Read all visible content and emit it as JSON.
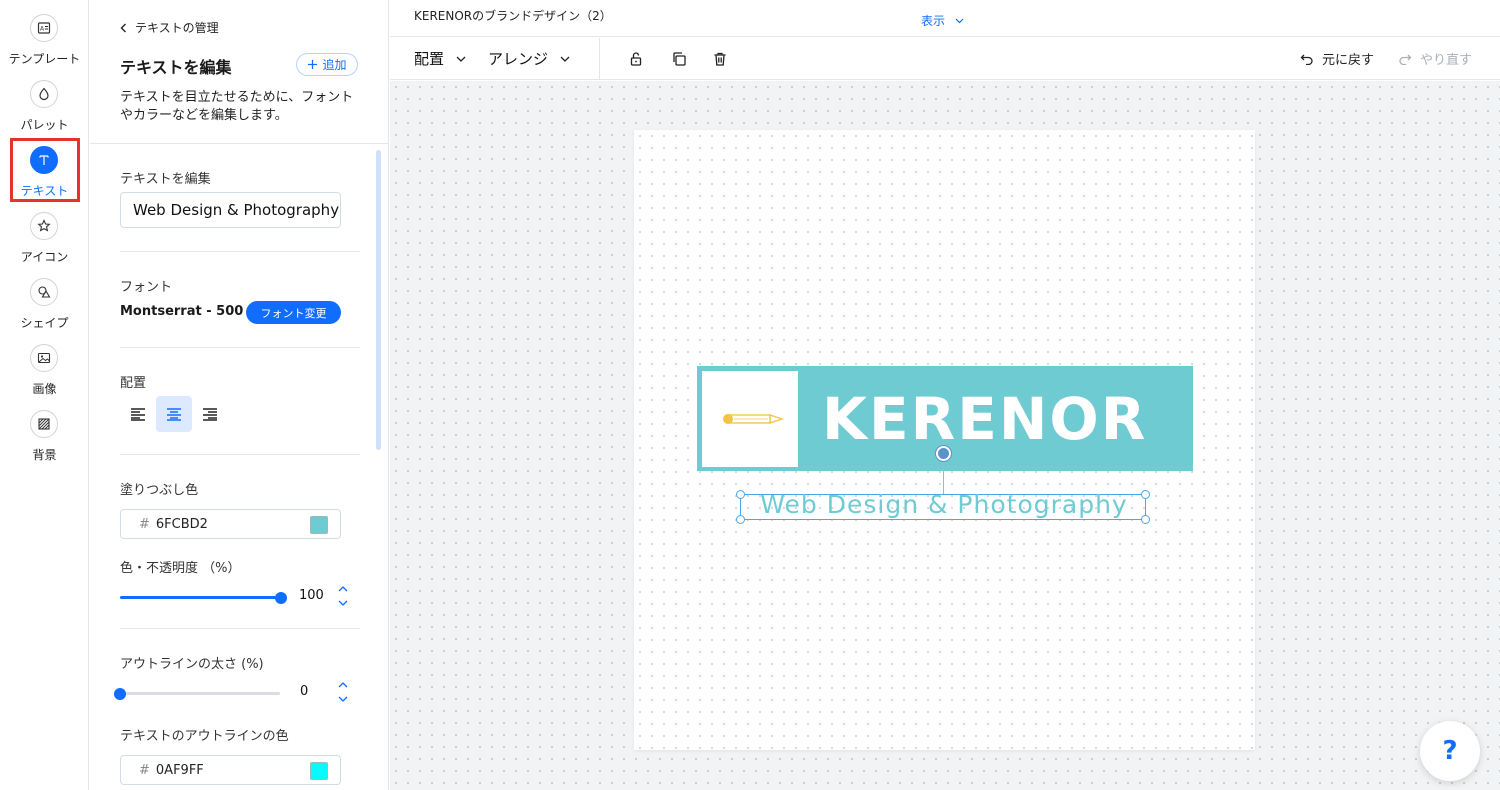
{
  "rail": {
    "items": [
      {
        "label": "テンプレート",
        "icon": "template-icon"
      },
      {
        "label": "パレット",
        "icon": "palette-icon"
      },
      {
        "label": "テキスト",
        "icon": "text-icon"
      },
      {
        "label": "アイコン",
        "icon": "star-icon"
      },
      {
        "label": "シェイプ",
        "icon": "shapes-icon"
      },
      {
        "label": "画像",
        "icon": "image-icon"
      },
      {
        "label": "背景",
        "icon": "background-icon"
      }
    ],
    "active": "テキスト"
  },
  "panel": {
    "back_label": "テキストの管理",
    "title": "テキストを編集",
    "add_label": "追加",
    "description": "テキストを目立たせるために、フォントやカラーなどを編集します。",
    "edit_text_label": "テキストを編集",
    "text_value": "Web Design & Photography",
    "font_label": "フォント",
    "font_name": "Montserrat - 500",
    "font_change_label": "フォント変更",
    "align_label": "配置",
    "alignment": "center",
    "fill_label": "塗りつぶし色",
    "fill_hex": "6FCBD2",
    "fill_color": "#6FCBD2",
    "opacity_label": "色・不透明度 （%）",
    "opacity_value": "100",
    "opacity_fraction": 1.0,
    "outline_width_label": "アウトラインの太さ (%)",
    "outline_width_value": "0",
    "outline_width_fraction": 0.0,
    "outline_color_label": "テキストのアウトラインの色",
    "outline_hex": "0AF9FF",
    "outline_color": "#0AF9FF",
    "hash": "#"
  },
  "topbar": {
    "doc_title": "KERENORのブランドデザイン（2）",
    "view_label": "表示"
  },
  "toolbar": {
    "arrange_label": "配置",
    "arrange2_label": "アレンジ",
    "undo_label": "元に戻す",
    "redo_label": "やり直す"
  },
  "canvas": {
    "brand_name": "KERENOR",
    "tagline": "Web Design & Photography",
    "bar_color": "#6FCBD2",
    "pencil_color": "#F5C342"
  },
  "help_label": "?",
  "colors": {
    "accent": "#116DFF",
    "highlight": "#E5322D"
  }
}
